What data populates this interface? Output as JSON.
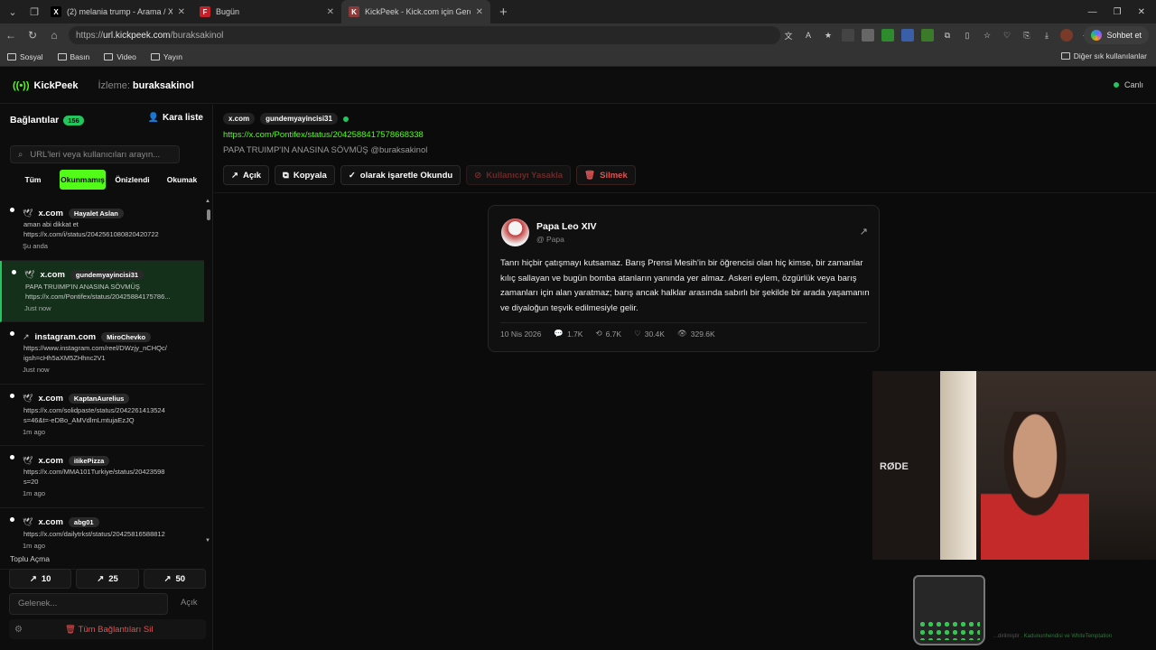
{
  "browser": {
    "tabs": [
      {
        "label": "(2) melania trump - Arama / X",
        "favicon": "X",
        "color": "#000000"
      },
      {
        "label": "Bugün",
        "favicon": "F",
        "color": "#c4202a"
      },
      {
        "label": "KickPeek - Kick.com için Gerçek Za",
        "favicon": "K",
        "color": "#8b3a3a",
        "active": true
      }
    ],
    "url_scheme": "https://",
    "url_host": "url.kickpeek.com",
    "url_path": "/buraksakinol",
    "chat_button": "Sohbet et",
    "bookmarks": [
      "Sosyal",
      "Basın",
      "Video",
      "Yayın"
    ],
    "other_bookmarks": "Diğer sık kullanılanlar"
  },
  "app": {
    "logo": "KickPeek",
    "watching_label": "İzleme:",
    "watching_user": "buraksakinol",
    "live_label": "Canlı"
  },
  "sidebar": {
    "title": "Bağlantılar",
    "count": "156",
    "blacklist": "Kara liste",
    "search_placeholder": "URL'leri veya kullanıcıları arayın...",
    "filters": [
      "Tüm",
      "Okunmamış",
      "Önizlendi",
      "Okumak"
    ],
    "items": [
      {
        "icon": "twitter-icon",
        "domain": "x.com",
        "user": "Hayalet Aslan",
        "lines": [
          "aman abi dikkat et",
          "https://x.com/i/status/2042561080820420722"
        ],
        "time": "Şu anda"
      },
      {
        "icon": "twitter-icon",
        "domain": "x.com",
        "user": "gundemyayincisi31",
        "lines": [
          "PAPA TRUIMP'IN ANASINA SÖVMÜŞ",
          "https://x.com/Pontifex/status/20425884175786..."
        ],
        "time": "Just now"
      },
      {
        "icon": "external-link-icon",
        "domain": "instagram.com",
        "user": "MiroChevko",
        "lines": [
          "https://www.instagram.com/reel/DWzjy_nCHQc/",
          "igsh=cHh5aXM5ZHhnc2V1"
        ],
        "time": "Just now"
      },
      {
        "icon": "twitter-icon",
        "domain": "x.com",
        "user": "KaptanAurelius",
        "lines": [
          "https://x.com/solidpaste/status/2042261413524",
          "s=46&t=-eDBo_AMVdlmLmtujaEzJQ"
        ],
        "time": "1m ago"
      },
      {
        "icon": "twitter-icon",
        "domain": "x.com",
        "user": "iIikePizza",
        "lines": [
          "https://x.com/MMA101Turkiye/status/20423598",
          "s=20"
        ],
        "time": "1m ago"
      },
      {
        "icon": "twitter-icon",
        "domain": "x.com",
        "user": "abg01",
        "lines": [
          "https://x.com/dailytrkst/status/20425816588812",
          ""
        ],
        "time": "1m ago"
      }
    ],
    "bulk_label": "Toplu Açma",
    "bulk_buttons": [
      "10",
      "25",
      "50"
    ],
    "habit_placeholder": "Gelenek...",
    "open_label": "Açık",
    "delete_all": "Tüm Bağlantıları Sil"
  },
  "main": {
    "domain_chip": "x.com",
    "user_chip": "gundemyayincisi31",
    "link": "https://x.com/Pontifex/status/2042588417578668338",
    "note": "PAPA TRUIMP'IN ANASINA SÖVMÜŞ @buraksakinol",
    "actions": [
      "Açık",
      "Kopyala",
      "olarak işaretle Okundu",
      "Kullanıcıyı Yasakla",
      "Silmek"
    ]
  },
  "tweet": {
    "name": "Papa Leo XIV",
    "handle": "@ Papa",
    "text": "Tanrı hiçbir çatışmayı kutsamaz. Barış Prensi Mesih'in bir öğrencisi olan hiç kimse, bir zamanlar kılıç sallayan ve bugün bomba atanların yanında yer almaz. Askeri eylem, özgürlük veya barış zamanları için alan yaratmaz; barış ancak halklar arasında sabırlı bir şekilde bir arada yaşamanın ve diyaloğun teşvik edilmesiyle gelir.",
    "date": "10 Nis 2026",
    "replies": "1.7K",
    "retweets": "6.7K",
    "likes": "30.4K",
    "views": "329.6K"
  },
  "overlay": {
    "cam_text": "RØDE",
    "credit_prefix": "...dirilmiştir .",
    "credit_names": "Kadununhendisi ve WhiteTemptation"
  },
  "colors": {
    "accent": "#53fc18",
    "live": "#22c55e",
    "danger": "#e05252"
  }
}
